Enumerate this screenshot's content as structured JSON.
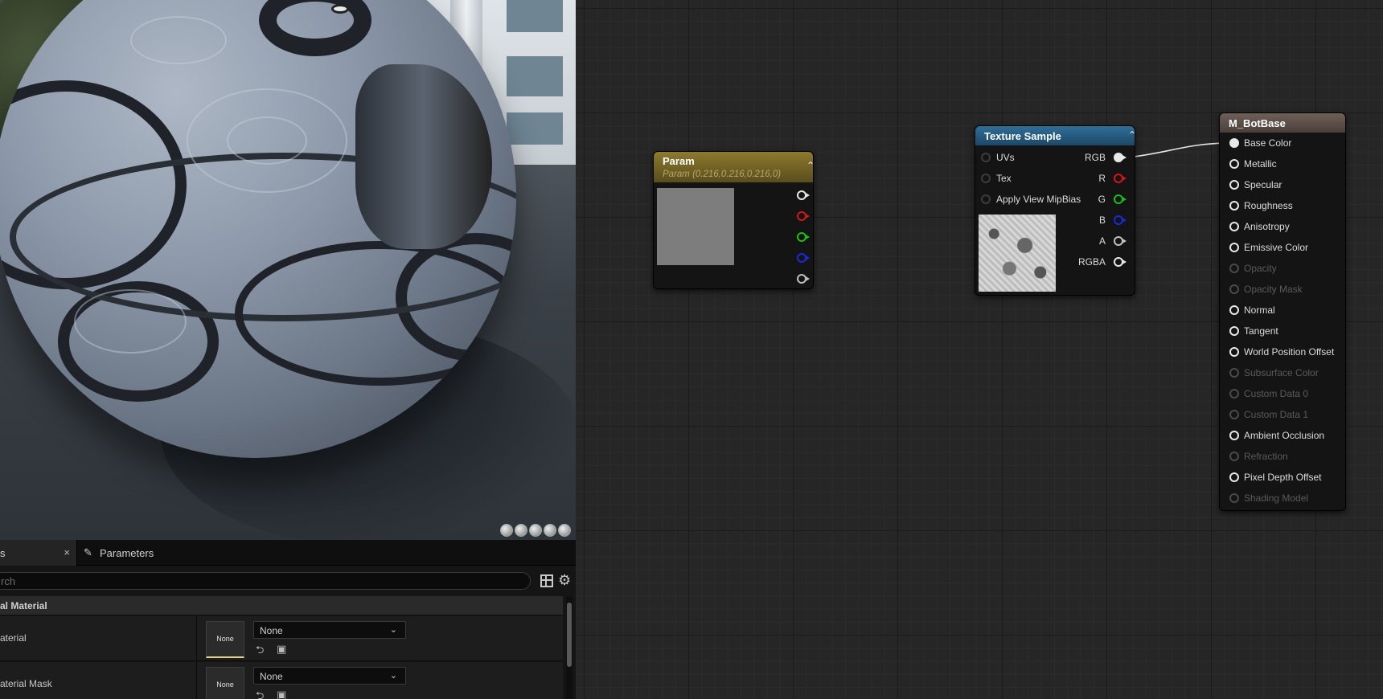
{
  "details": {
    "tab_label": "s",
    "tab_close": "×",
    "tab2_label": "Parameters",
    "search_placeholder": "rch",
    "category": "al Material",
    "rows": [
      {
        "label": "aterial",
        "thumb": "None",
        "combo": "None"
      },
      {
        "label": "aterial Mask",
        "thumb": "None",
        "combo": "None"
      }
    ]
  },
  "nodes": {
    "param": {
      "title": "Param",
      "subtitle": "Param (0.216,0.216,0.216,0)",
      "color": "#8c7a2e"
    },
    "texture": {
      "title": "Texture Sample",
      "color": "#2f6e98",
      "inputs": [
        "UVs",
        "Tex",
        "Apply View MipBias"
      ],
      "outputs": [
        "RGB",
        "R",
        "G",
        "B",
        "A",
        "RGBA"
      ]
    },
    "base": {
      "title": "M_BotBase",
      "color": "#6f6058",
      "pins": [
        {
          "label": "Base Color",
          "active": true
        },
        {
          "label": "Metallic",
          "active": true
        },
        {
          "label": "Specular",
          "active": true
        },
        {
          "label": "Roughness",
          "active": true
        },
        {
          "label": "Anisotropy",
          "active": true
        },
        {
          "label": "Emissive Color",
          "active": true
        },
        {
          "label": "Opacity",
          "active": false
        },
        {
          "label": "Opacity Mask",
          "active": false
        },
        {
          "label": "Normal",
          "active": true
        },
        {
          "label": "Tangent",
          "active": true
        },
        {
          "label": "World Position Offset",
          "active": true
        },
        {
          "label": "Subsurface Color",
          "active": false
        },
        {
          "label": "Custom Data 0",
          "active": false
        },
        {
          "label": "Custom Data 1",
          "active": false
        },
        {
          "label": "Ambient Occlusion",
          "active": true
        },
        {
          "label": "Refraction",
          "active": false
        },
        {
          "label": "Pixel Depth Offset",
          "active": true
        },
        {
          "label": "Shading Model",
          "active": false
        }
      ]
    }
  },
  "pin_colors": {
    "white": "#e8e8e8",
    "red": "#d01818",
    "green": "#18c018",
    "blue": "#1a2ad8",
    "grey": "#bfbfbf"
  }
}
